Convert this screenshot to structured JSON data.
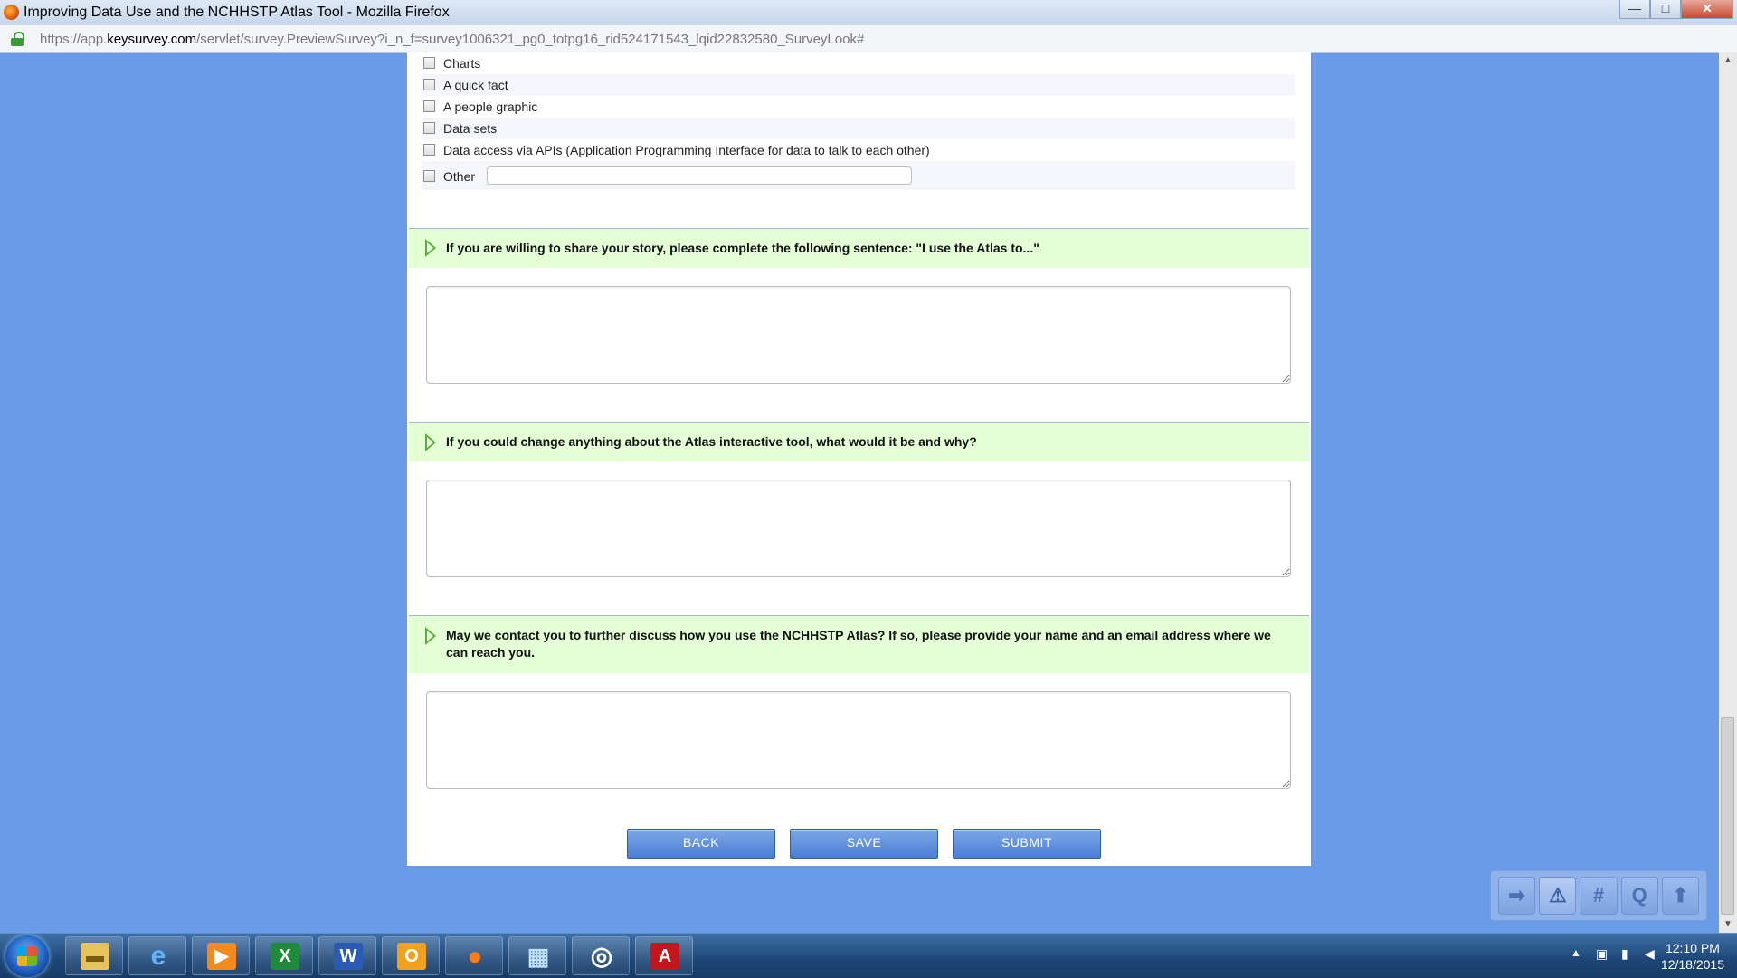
{
  "window": {
    "title": "Improving Data Use and the NCHHSTP Atlas Tool - Mozilla Firefox",
    "controls": {
      "minimize": "—",
      "maximize": "□",
      "close": "✕"
    }
  },
  "address_bar": {
    "url_prefix": "https://app.",
    "url_domain": "keysurvey.com",
    "url_rest": "/servlet/survey.PreviewSurvey?i_n_f=survey1006321_pg0_totpg16_rid524171543_lqid22832580_SurveyLook#"
  },
  "choices": [
    {
      "label": "Charts",
      "checked": false
    },
    {
      "label": "A quick fact",
      "checked": false
    },
    {
      "label": "A people graphic",
      "checked": false
    },
    {
      "label": "Data sets",
      "checked": false
    },
    {
      "label": "Data access via APIs (Application Programming Interface for data to talk to each other)",
      "checked": false
    },
    {
      "label": "Other",
      "checked": false,
      "text_value": ""
    }
  ],
  "questions": [
    {
      "text": "If you are willing to share your story, please complete the following sentence: \"I use the Atlas to...\"",
      "answer": ""
    },
    {
      "text": "If you could change anything about the Atlas interactive tool, what would it be and why?",
      "answer": ""
    },
    {
      "text": "May we contact you to further discuss how you use the NCHHSTP Atlas? If so, please provide your name and an email address where we can reach you.",
      "answer": ""
    }
  ],
  "buttons": {
    "back": "BACK",
    "save": "SAVE",
    "submit": "SUBMIT"
  },
  "tool_panel": [
    {
      "icon": "next-arrow-icon",
      "glyph": "➡"
    },
    {
      "icon": "warning-icon",
      "glyph": "⚠"
    },
    {
      "icon": "question-number-icon",
      "glyph": "#"
    },
    {
      "icon": "question-search-icon",
      "glyph": "Q"
    },
    {
      "icon": "scroll-top-icon",
      "glyph": "⬆"
    }
  ],
  "taskbar": {
    "apps": [
      {
        "icon": "file-explorer-icon",
        "glyph": "▬",
        "color": "#e8c25a"
      },
      {
        "icon": "internet-explorer-icon",
        "glyph": "e",
        "color": "#2f8fe0"
      },
      {
        "icon": "media-player-icon",
        "glyph": "▶",
        "color": "#f28a1d"
      },
      {
        "icon": "excel-icon",
        "glyph": "X",
        "color": "#1f8a3c"
      },
      {
        "icon": "word-icon",
        "glyph": "W",
        "color": "#2b5bb7"
      },
      {
        "icon": "outlook-icon",
        "glyph": "O",
        "color": "#f0a21c"
      },
      {
        "icon": "firefox-icon",
        "glyph": "●",
        "color": "#e0661b"
      },
      {
        "icon": "network-app-icon",
        "glyph": "▦",
        "color": "#8fbfe6"
      },
      {
        "icon": "target-app-icon",
        "glyph": "◎",
        "color": "#444444"
      },
      {
        "icon": "adobe-reader-icon",
        "glyph": "A",
        "color": "#c4161c"
      }
    ],
    "time": "12:10 PM",
    "date": "12/18/2015"
  }
}
